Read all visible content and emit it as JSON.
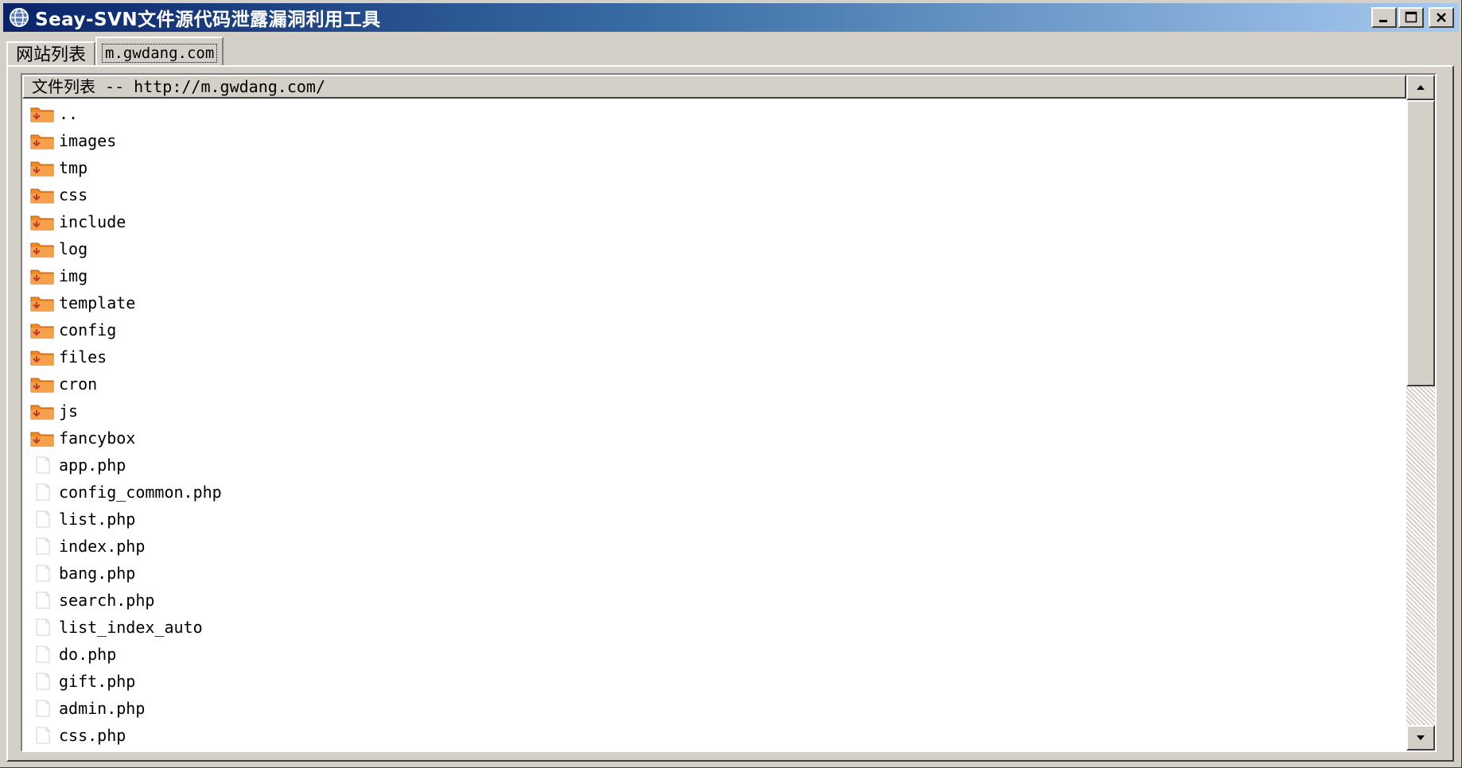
{
  "window": {
    "title": "Seay-SVN文件源代码泄露漏洞利用工具",
    "icon": "app-globe-icon",
    "buttons": [
      "minimize-icon",
      "maximize-icon",
      "close-icon"
    ]
  },
  "tabs": [
    {
      "label": "网站列表",
      "active": false
    },
    {
      "label": "m.gwdang.com",
      "active": true
    }
  ],
  "file_list": {
    "header": "文件列表 -- http://m.gwdang.com/",
    "rows": [
      {
        "name": "..",
        "type": "folder"
      },
      {
        "name": "images",
        "type": "folder"
      },
      {
        "name": "tmp",
        "type": "folder"
      },
      {
        "name": "css",
        "type": "folder"
      },
      {
        "name": "include",
        "type": "folder"
      },
      {
        "name": "log",
        "type": "folder"
      },
      {
        "name": "img",
        "type": "folder"
      },
      {
        "name": "template",
        "type": "folder"
      },
      {
        "name": "config",
        "type": "folder"
      },
      {
        "name": "files",
        "type": "folder"
      },
      {
        "name": "cron",
        "type": "folder"
      },
      {
        "name": "js",
        "type": "folder"
      },
      {
        "name": "fancybox",
        "type": "folder"
      },
      {
        "name": "app.php",
        "type": "file"
      },
      {
        "name": "config_common.php",
        "type": "file"
      },
      {
        "name": "list.php",
        "type": "file"
      },
      {
        "name": "index.php",
        "type": "file"
      },
      {
        "name": "bang.php",
        "type": "file"
      },
      {
        "name": "search.php",
        "type": "file"
      },
      {
        "name": "list_index_auto",
        "type": "file"
      },
      {
        "name": "do.php",
        "type": "file"
      },
      {
        "name": "gift.php",
        "type": "file"
      },
      {
        "name": "admin.php",
        "type": "file"
      },
      {
        "name": "css.php",
        "type": "file"
      }
    ]
  },
  "colors": {
    "title_gradient_start": "#0a246a",
    "title_gradient_end": "#a6caf0",
    "folder_orange": "#f08a24",
    "chrome_gray": "#d4d0c8"
  }
}
